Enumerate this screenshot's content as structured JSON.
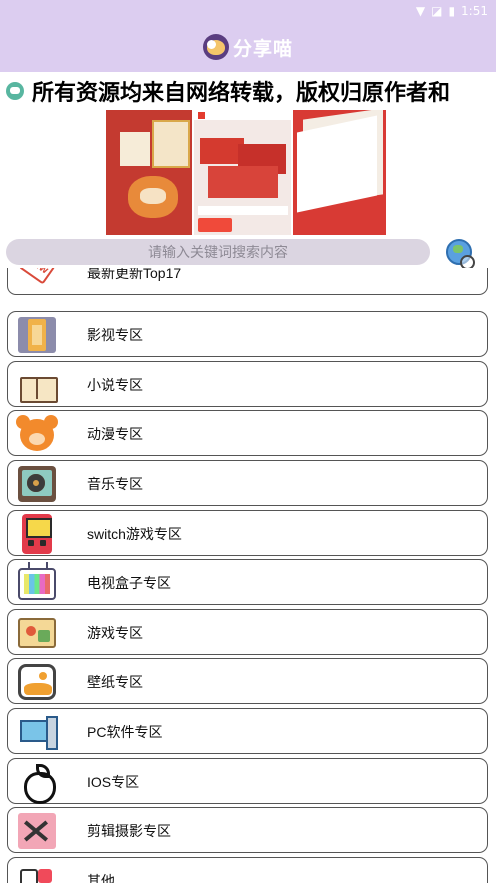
{
  "status_bar": {
    "time": "1:51"
  },
  "app": {
    "title": "分享喵"
  },
  "marquee": {
    "text": "所有资源均来自网络转载，版权归原作者和"
  },
  "search": {
    "placeholder": "请输入关键词搜索内容"
  },
  "categories": [
    {
      "label": "最新更新Top17",
      "icon": "new-badge-icon"
    },
    {
      "label": "影视专区",
      "icon": "film-icon"
    },
    {
      "label": "小说专区",
      "icon": "book-icon"
    },
    {
      "label": "动漫专区",
      "icon": "bear-icon"
    },
    {
      "label": "音乐专区",
      "icon": "record-player-icon"
    },
    {
      "label": "switch游戏专区",
      "icon": "handheld-console-icon"
    },
    {
      "label": "电视盒子专区",
      "icon": "tv-icon"
    },
    {
      "label": "游戏专区",
      "icon": "game-card-icon"
    },
    {
      "label": "壁纸专区",
      "icon": "wallpaper-icon"
    },
    {
      "label": "PC软件专区",
      "icon": "pc-icon"
    },
    {
      "label": "IOS专区",
      "icon": "apple-icon"
    },
    {
      "label": "剪辑摄影专区",
      "icon": "scissors-icon"
    },
    {
      "label": "其他",
      "icon": "other-icon"
    }
  ],
  "colors": {
    "header_bg": "#dccdf0",
    "search_bg": "#dbd5e1",
    "item_border": "#555555"
  }
}
